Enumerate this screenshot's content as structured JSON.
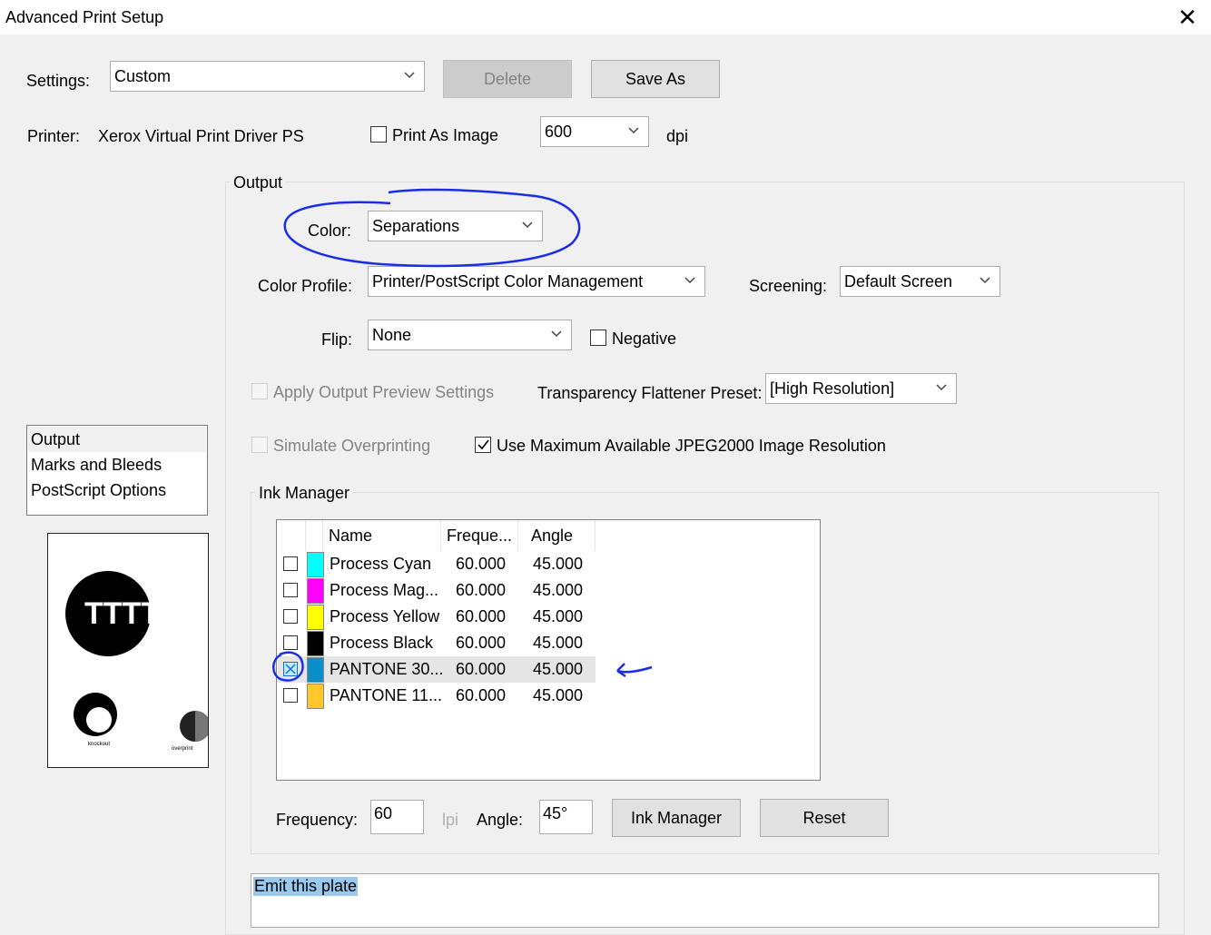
{
  "window": {
    "title": "Advanced Print Setup",
    "close_glyph": "✕"
  },
  "settings": {
    "label": "Settings:",
    "value": "Custom",
    "delete_label": "Delete",
    "save_as_label": "Save As"
  },
  "printer": {
    "label": "Printer:",
    "name": "Xerox Virtual Print Driver PS",
    "print_as_image_label": "Print As Image",
    "print_as_image_checked": false,
    "dpi_value": "600",
    "dpi_unit": "dpi"
  },
  "nav": {
    "items": [
      "Output",
      "Marks and Bleeds",
      "PostScript Options"
    ],
    "selected": "Output"
  },
  "preview": {
    "knockout_label": "knockout",
    "overprint_label": "overprint",
    "tag_text": "TTTT"
  },
  "output": {
    "group_label": "Output",
    "color_label": "Color:",
    "color_value": "Separations",
    "color_profile_label": "Color Profile:",
    "color_profile_value": "Printer/PostScript Color Management",
    "screening_label": "Screening:",
    "screening_value": "Default Screen",
    "flip_label": "Flip:",
    "flip_value": "None",
    "negative_label": "Negative",
    "negative_checked": false,
    "apply_preview_label": "Apply Output Preview Settings",
    "flattener_label": "Transparency Flattener Preset:",
    "flattener_value": "[High Resolution]",
    "simulate_overprint_label": "Simulate Overprinting",
    "jpeg2000_label": "Use Maximum Available JPEG2000 Image Resolution",
    "jpeg2000_checked": true
  },
  "ink_manager": {
    "group_label": "Ink Manager",
    "columns": {
      "name": "Name",
      "frequency": "Freque...",
      "angle": "Angle"
    },
    "rows": [
      {
        "name": "Process Cyan",
        "frequency": "60.000",
        "angle": "45.000",
        "color": "#00ffff",
        "checked": false
      },
      {
        "name": "Process Mag...",
        "frequency": "60.000",
        "angle": "45.000",
        "color": "#ff00ff",
        "checked": false
      },
      {
        "name": "Process Yellow",
        "frequency": "60.000",
        "angle": "45.000",
        "color": "#ffff00",
        "checked": false
      },
      {
        "name": "Process Black",
        "frequency": "60.000",
        "angle": "45.000",
        "color": "#000000",
        "checked": false
      },
      {
        "name": "PANTONE 30...",
        "frequency": "60.000",
        "angle": "45.000",
        "color": "#0a8fc9",
        "checked": true
      },
      {
        "name": "PANTONE 11...",
        "frequency": "60.000",
        "angle": "45.000",
        "color": "#ffc72c",
        "checked": false
      }
    ],
    "frequency_label": "Frequency:",
    "frequency_value": "60",
    "lpi_label": "lpi",
    "angle_label": "Angle:",
    "angle_value": "45°",
    "ink_manager_button": "Ink Manager",
    "reset_button": "Reset"
  },
  "description": {
    "text": "Emit this plate"
  },
  "annotation_color": "#1a2ee6"
}
